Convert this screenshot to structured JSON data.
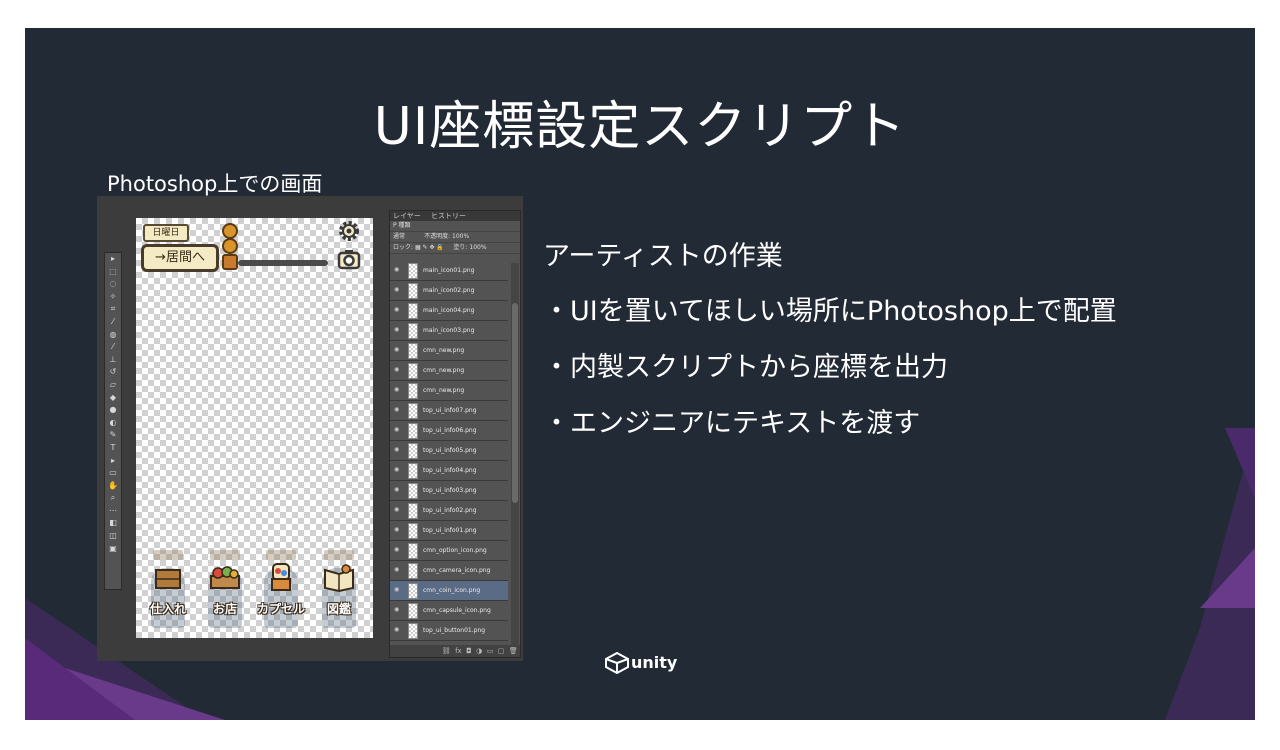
{
  "slide": {
    "title": "UI座標設定スクリプト",
    "caption": "Photoshop上での画面"
  },
  "text_block": {
    "heading": "アーティストの作業",
    "bullets": [
      "・UIを置いてほしい場所にPhotoshop上で配置",
      "・内製スクリプトから座標を出力",
      "・エンジニアにテキストを渡す"
    ]
  },
  "game_ui": {
    "day_label": "日曜日",
    "home_button": "→居間へ",
    "bottom_items": [
      "仕入れ",
      "お店",
      "カプセル",
      "図鑑"
    ]
  },
  "layers_panel": {
    "tabs": [
      "レイヤー",
      "ヒストリー"
    ],
    "filter": "P 種類",
    "blend_mode": "通常",
    "opacity_label": "不透明度",
    "opacity_value": "100%",
    "lock_label": "ロック",
    "fill_label": "塗り",
    "fill_value": "100%",
    "layers": [
      {
        "name": "main_icon01.png",
        "selected": false
      },
      {
        "name": "main_icon02.png",
        "selected": false
      },
      {
        "name": "main_icon04.png",
        "selected": false
      },
      {
        "name": "main_icon03.png",
        "selected": false
      },
      {
        "name": "cmn_new.png",
        "selected": false
      },
      {
        "name": "cmn_new.png",
        "selected": false
      },
      {
        "name": "cmn_new.png",
        "selected": false
      },
      {
        "name": "top_ui_info07.png",
        "selected": false
      },
      {
        "name": "top_ui_info06.png",
        "selected": false
      },
      {
        "name": "top_ui_info05.png",
        "selected": false
      },
      {
        "name": "top_ui_info04.png",
        "selected": false
      },
      {
        "name": "top_ui_info03.png",
        "selected": false
      },
      {
        "name": "top_ui_info02.png",
        "selected": false
      },
      {
        "name": "top_ui_info01.png",
        "selected": false
      },
      {
        "name": "cmn_option_icon.png",
        "selected": false
      },
      {
        "name": "cmn_camera_icon.png",
        "selected": false
      },
      {
        "name": "cmn_coin_icon.png",
        "selected": true
      },
      {
        "name": "cmn_capsule_icon.png",
        "selected": false
      },
      {
        "name": "top_ui_button01.png",
        "selected": false
      }
    ]
  },
  "logo": {
    "text": "unity"
  },
  "colors": {
    "slide_bg": "#222a35",
    "accent_purple": "#5a2a7a"
  }
}
